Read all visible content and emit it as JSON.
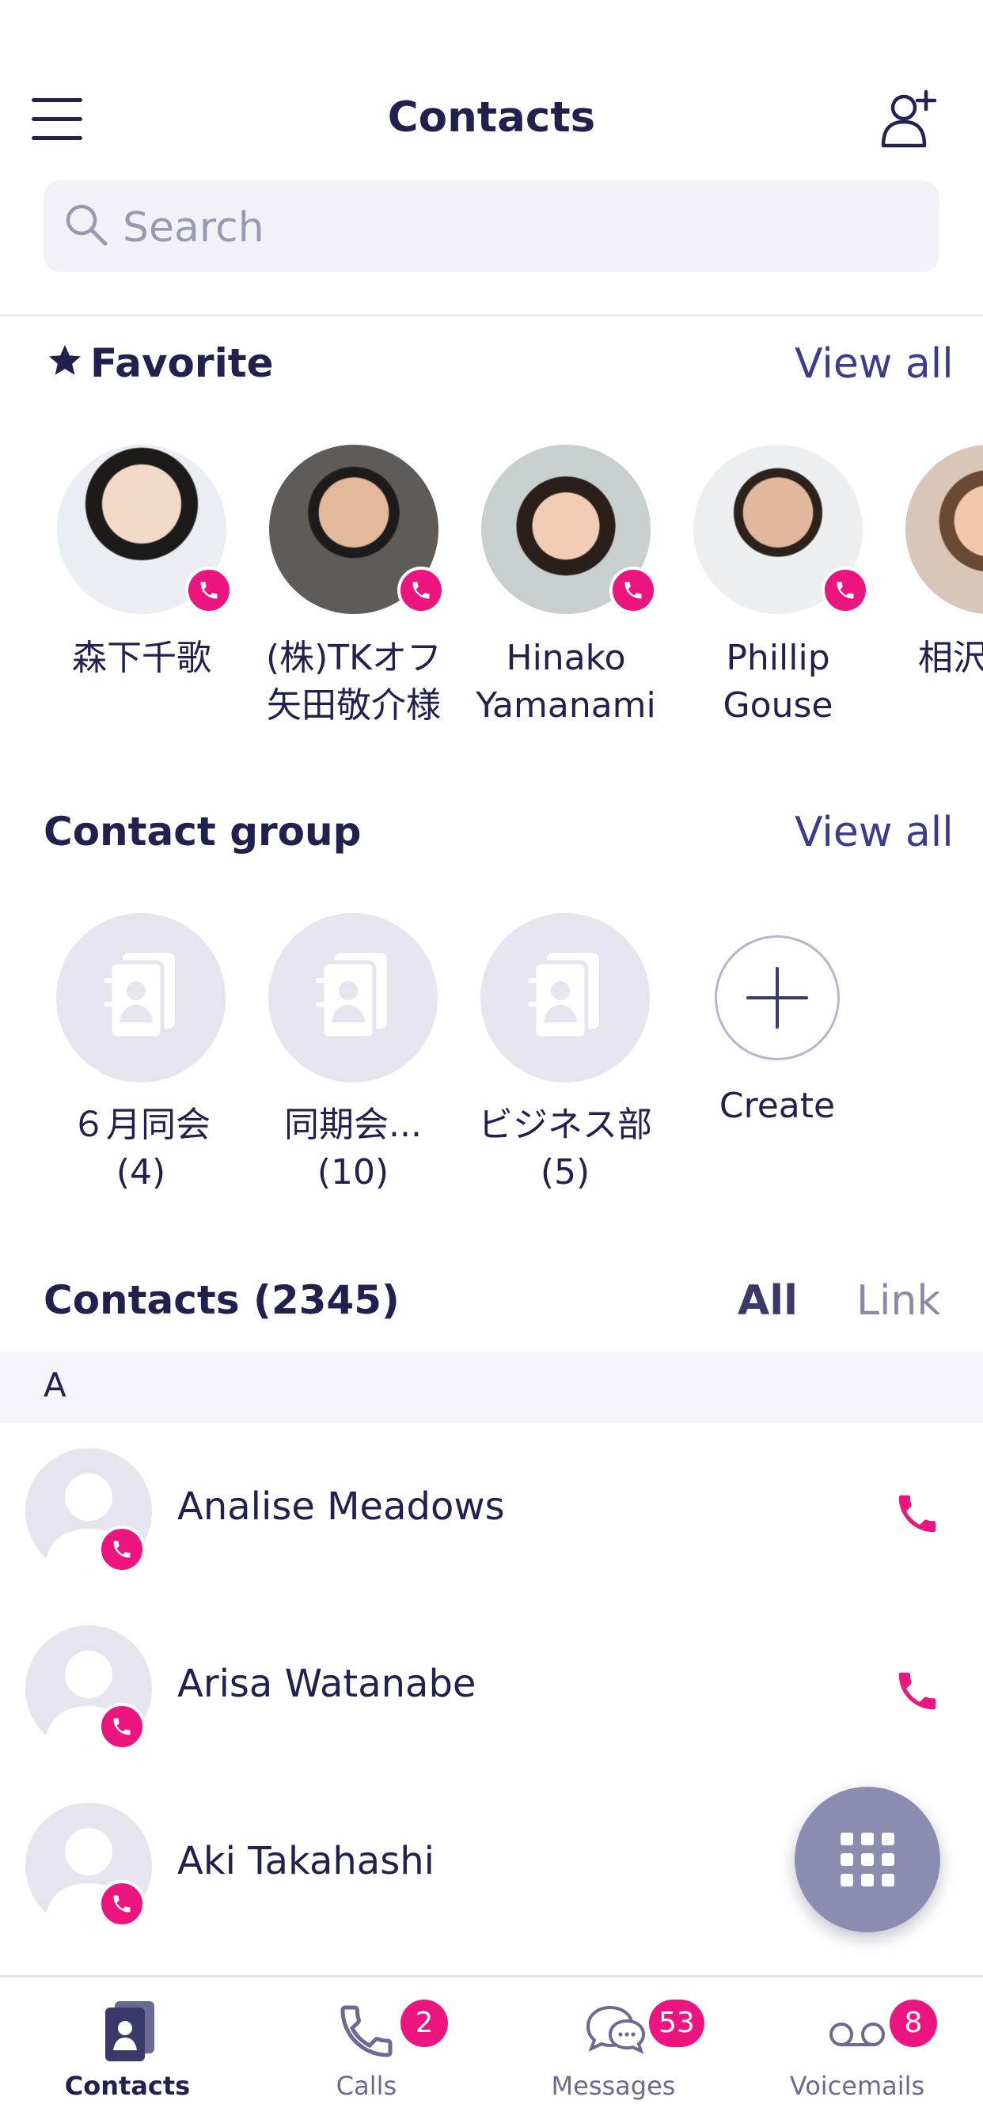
{
  "header": {
    "title": "Contacts",
    "search_placeholder": "Search"
  },
  "favorites": {
    "title": "Favorite",
    "view_all": "View all",
    "items": [
      {
        "name": "森下千歌"
      },
      {
        "name": "(株)TKオフ矢田敬介様"
      },
      {
        "name": "Hinako Yamanami"
      },
      {
        "name": "Phillip Gouse"
      },
      {
        "name": "相沢"
      }
    ]
  },
  "groups": {
    "title": "Contact group",
    "view_all": "View all",
    "items": [
      {
        "name": "６月同会",
        "count": "(4)"
      },
      {
        "name": "同期会...",
        "count": "(10)"
      },
      {
        "name": "ビジネス部",
        "count": "(5)"
      }
    ],
    "create_label": "Create"
  },
  "contacts": {
    "title": "Contacts (2345)",
    "filter_all": "All",
    "filter_link": "Link",
    "index_letter": "A",
    "items": [
      {
        "name": "Analise Meadows"
      },
      {
        "name": "Arisa Watanabe"
      },
      {
        "name": "Aki Takahashi"
      }
    ]
  },
  "tabbar": {
    "items": [
      {
        "label": "Contacts",
        "icon": "contacts-icon",
        "badge": ""
      },
      {
        "label": "Calls",
        "icon": "phone-icon",
        "badge": "2"
      },
      {
        "label": "Messages",
        "icon": "chat-icon",
        "badge": "53"
      },
      {
        "label": "Voicemails",
        "icon": "voicemail-icon",
        "badge": "8"
      }
    ]
  },
  "colors": {
    "accent": "#ec147e",
    "primary": "#22204f",
    "link": "#3c3b8f",
    "fab": "#8c8bb0"
  }
}
